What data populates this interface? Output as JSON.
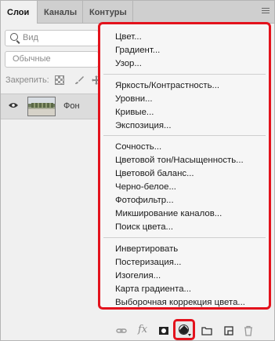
{
  "tabs": [
    {
      "label": "Слои"
    },
    {
      "label": "Каналы"
    },
    {
      "label": "Контуры"
    }
  ],
  "search": {
    "placeholder": "Вид"
  },
  "blend_mode": {
    "value": "Обычные"
  },
  "lock": {
    "label": "Закрепить:"
  },
  "layer": {
    "name": "Фон"
  },
  "menu": {
    "groups": [
      [
        "Цвет...",
        "Градиент...",
        "Узор..."
      ],
      [
        "Яркость/Контрастность...",
        "Уровни...",
        "Кривые...",
        "Экспозиция..."
      ],
      [
        "Сочность...",
        "Цветовой тон/Насыщенность...",
        "Цветовой баланс...",
        "Черно-белое...",
        "Фотофильтр...",
        "Микширование каналов...",
        "Поиск цвета..."
      ],
      [
        "Инвертировать",
        "Постеризация...",
        "Изогелия...",
        "Карта градиента...",
        "Выборочная коррекция цвета..."
      ]
    ]
  },
  "toolbar": {
    "fx_label": "fx",
    "icons": [
      "link-icon",
      "fx-icon",
      "mask-icon",
      "adjustment-layer-icon",
      "folder-icon",
      "new-layer-icon",
      "trash-icon"
    ]
  },
  "colors": {
    "highlight": "#e3121c"
  }
}
